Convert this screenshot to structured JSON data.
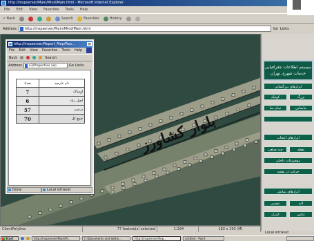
{
  "main_window": {
    "title": "http://inspserver/Main/Mind/Main.html - Microsoft Internet Explorer",
    "menu": [
      "File",
      "Edit",
      "View",
      "Favorites",
      "Tools",
      "Help"
    ],
    "toolbar": {
      "back": "⇦ Back",
      "search": "Search",
      "favorites": "Favorites",
      "history": "History"
    },
    "address_label": "Address",
    "address_url": "http://inspserver/Main/Mind/Main.html",
    "go": "Go",
    "links": "Links"
  },
  "map": {
    "street_label": "بلوار کشاورز",
    "colors": {
      "background": "#2f4a41",
      "band_light": "#9c9d88",
      "band_dark": "#5e6b5a",
      "band_green": "#76826c",
      "marker": "#bfc5b9"
    }
  },
  "sidebar": {
    "header_line1": "سیستم اطلاعات جغرافیایی",
    "header_line2": "خدمات شهری تهران",
    "section_1_title": "ابزارهای بزرگنمایی",
    "section_1_buttons": [
      "بزرگ",
      "کوچک",
      "جابجایی",
      "تمام نما",
      ""
    ],
    "section_2_title": "ابزارهای انتخاب",
    "section_2_buttons": [
      "نقطه",
      "چند ضلعی",
      "موضوعات داخلی",
      "حرکت در نقشه"
    ],
    "section_3_title": "ابزارهای نمایش",
    "section_3_buttons": [
      "لایه",
      "تفسیر",
      "عکس",
      "کنترل"
    ],
    "status": "Local intranet"
  },
  "statusbar": {
    "left": "ClientPolyline:",
    "selected": "77 feature(s) selected",
    "scale": "1:294",
    "coords": "182 x 193 (M)"
  },
  "taskbar": {
    "start": "Start",
    "tasks": [
      "http://inspserver/Main/M...",
      "C:\\Documents and Settin...",
      "http://inspserver/Rep...",
      "untitled - Paint"
    ],
    "active_index": 2
  },
  "popup": {
    "title": "http://inspserver/Report_Map/Rep...",
    "menu": [
      "File",
      "Edit",
      "View",
      "Favorites",
      "Tools",
      "Help"
    ],
    "back": "Back",
    "search": "Search",
    "address_label": "Address",
    "address_url": "a3/Properties.asp",
    "go": "Go",
    "links": "Links",
    "table": {
      "header_name": "نام عارضه",
      "header_count": "تعداد",
      "rows": [
        {
          "name": "اوساک",
          "count": "7"
        },
        {
          "name": "اصل زیاد",
          "count": "6"
        },
        {
          "name": "درخت",
          "count": "57"
        },
        {
          "name": "جمع کل",
          "count": "70"
        }
      ]
    },
    "status_left": "Done",
    "status_right": "Local intranet"
  }
}
